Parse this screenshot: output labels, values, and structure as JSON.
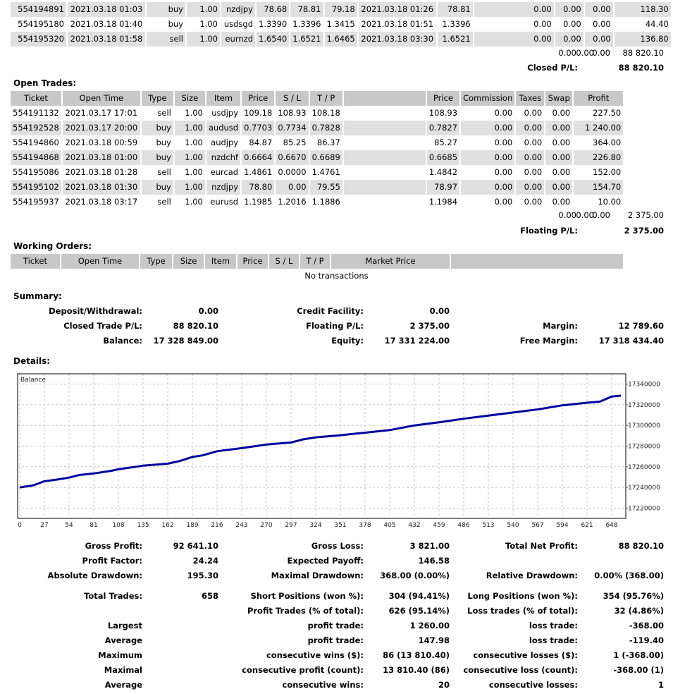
{
  "closed_trades": {
    "rows": [
      {
        "ticket": "554194891",
        "open_time": "2021.03.18 01:03",
        "type": "buy",
        "size": "1.00",
        "item": "nzdjpy",
        "price": "78.68",
        "sl": "78.81",
        "tp": "79.18",
        "close_time": "2021.03.18 01:26",
        "close_price": "78.81",
        "commission": "0.00",
        "taxes": "0.00",
        "swap": "0.00",
        "profit": "118.30"
      },
      {
        "ticket": "554195180",
        "open_time": "2021.03.18 01:40",
        "type": "buy",
        "size": "1.00",
        "item": "usdsgd",
        "price": "1.3390",
        "sl": "1.3396",
        "tp": "1.3415",
        "close_time": "2021.03.18 01:51",
        "close_price": "1.3396",
        "commission": "0.00",
        "taxes": "0.00",
        "swap": "0.00",
        "profit": "44.40"
      },
      {
        "ticket": "554195320",
        "open_time": "2021.03.18 01:58",
        "type": "sell",
        "size": "1.00",
        "item": "eurnzd",
        "price": "1.6540",
        "sl": "1.6521",
        "tp": "1.6465",
        "close_time": "2021.03.18 03:30",
        "close_price": "1.6521",
        "commission": "0.00",
        "taxes": "0.00",
        "swap": "0.00",
        "profit": "136.80"
      }
    ],
    "totals": {
      "commission": "0.00",
      "taxes": "0.00",
      "swap": "0.00",
      "profit": "88 820.10"
    },
    "pl_label": "Closed P/L:",
    "pl_value": "88 820.10"
  },
  "open_trades": {
    "title": "Open Trades:",
    "headers": [
      "Ticket",
      "Open Time",
      "Type",
      "Size",
      "Item",
      "Price",
      "S / L",
      "T / P",
      "",
      "Price",
      "Commission",
      "Taxes",
      "Swap",
      "Profit"
    ],
    "rows": [
      {
        "ticket": "554191132",
        "open_time": "2021.03.17 17:01",
        "type": "sell",
        "size": "1.00",
        "item": "usdjpy",
        "price": "109.18",
        "sl": "108.93",
        "tp": "108.18",
        "market_price": "108.93",
        "commission": "0.00",
        "taxes": "0.00",
        "swap": "0.00",
        "profit": "227.50"
      },
      {
        "ticket": "554192528",
        "open_time": "2021.03.17 20:00",
        "type": "buy",
        "size": "1.00",
        "item": "audusd",
        "price": "0.7703",
        "sl": "0.7734",
        "tp": "0.7828",
        "market_price": "0.7827",
        "commission": "0.00",
        "taxes": "0.00",
        "swap": "0.00",
        "profit": "1 240.00"
      },
      {
        "ticket": "554194860",
        "open_time": "2021.03.18 00:59",
        "type": "buy",
        "size": "1.00",
        "item": "audjpy",
        "price": "84.87",
        "sl": "85.25",
        "tp": "86.37",
        "market_price": "85.27",
        "commission": "0.00",
        "taxes": "0.00",
        "swap": "0.00",
        "profit": "364.00"
      },
      {
        "ticket": "554194868",
        "open_time": "2021.03.18 01:00",
        "type": "buy",
        "size": "1.00",
        "item": "nzdchf",
        "price": "0.6664",
        "sl": "0.6670",
        "tp": "0.6689",
        "market_price": "0.6685",
        "commission": "0.00",
        "taxes": "0.00",
        "swap": "0.00",
        "profit": "226.80"
      },
      {
        "ticket": "554195086",
        "open_time": "2021.03.18 01:28",
        "type": "sell",
        "size": "1.00",
        "item": "eurcad",
        "price": "1.4861",
        "sl": "0.0000",
        "tp": "1.4761",
        "market_price": "1.4842",
        "commission": "0.00",
        "taxes": "0.00",
        "swap": "0.00",
        "profit": "152.00"
      },
      {
        "ticket": "554195102",
        "open_time": "2021.03.18 01:30",
        "type": "buy",
        "size": "1.00",
        "item": "nzdjpy",
        "price": "78.80",
        "sl": "0.00",
        "tp": "79.55",
        "market_price": "78.97",
        "commission": "0.00",
        "taxes": "0.00",
        "swap": "0.00",
        "profit": "154.70"
      },
      {
        "ticket": "554195937",
        "open_time": "2021.03.18 03:17",
        "type": "sell",
        "size": "1.00",
        "item": "eurusd",
        "price": "1.1985",
        "sl": "1.2016",
        "tp": "1.1886",
        "market_price": "1.1984",
        "commission": "0.00",
        "taxes": "0.00",
        "swap": "0.00",
        "profit": "10.00"
      }
    ],
    "totals": {
      "commission": "0.00",
      "taxes": "0.00",
      "swap": "0.00",
      "profit": "2 375.00"
    },
    "pl_label": "Floating P/L:",
    "pl_value": "2 375.00"
  },
  "working_orders": {
    "title": "Working Orders:",
    "headers": [
      "Ticket",
      "Open Time",
      "Type",
      "Size",
      "Item",
      "Price",
      "S / L",
      "T / P",
      "Market Price",
      ""
    ],
    "empty_text": "No transactions"
  },
  "summary": {
    "title": "Summary:",
    "deposit_label": "Deposit/Withdrawal:",
    "deposit_value": "0.00",
    "credit_label": "Credit Facility:",
    "credit_value": "0.00",
    "closed_pl_label": "Closed Trade P/L:",
    "closed_pl_value": "88 820.10",
    "floating_pl_label": "Floating P/L:",
    "floating_pl_value": "2 375.00",
    "margin_label": "Margin:",
    "margin_value": "12 789.60",
    "balance_label": "Balance:",
    "balance_value": "17 328 849.00",
    "equity_label": "Equity:",
    "equity_value": "17 331 224.00",
    "free_margin_label": "Free Margin:",
    "free_margin_value": "17 318 434.40"
  },
  "details": {
    "title": "Details:"
  },
  "chart_data": {
    "type": "line",
    "title": "Balance",
    "xlabel": "",
    "ylabel": "",
    "x_ticks": [
      0,
      27,
      54,
      81,
      108,
      135,
      162,
      189,
      216,
      243,
      270,
      297,
      324,
      351,
      378,
      405,
      432,
      459,
      486,
      513,
      540,
      567,
      594,
      621,
      648
    ],
    "y_ticks": [
      17220000,
      17240000,
      17260000,
      17280000,
      17300000,
      17320000,
      17340000
    ],
    "xlim": [
      0,
      658
    ],
    "ylim": [
      17210000,
      17350000
    ],
    "grid": true,
    "line_color": "#0000a0",
    "series": [
      {
        "name": "Balance",
        "x": [
          0,
          15,
          27,
          40,
          54,
          65,
          81,
          100,
          108,
          135,
          162,
          175,
          189,
          200,
          216,
          243,
          270,
          297,
          310,
          324,
          351,
          378,
          405,
          432,
          459,
          486,
          513,
          540,
          567,
          594,
          621,
          635,
          648,
          658
        ],
        "values": [
          17240000,
          17242000,
          17246000,
          17247500,
          17249500,
          17252000,
          17253500,
          17256000,
          17257500,
          17261000,
          17263000,
          17265500,
          17269500,
          17271000,
          17275000,
          17278000,
          17281500,
          17283500,
          17286500,
          17288500,
          17290500,
          17293000,
          17295500,
          17300000,
          17303000,
          17306500,
          17309500,
          17312500,
          17315500,
          17319500,
          17322000,
          17323000,
          17328000,
          17328849
        ]
      }
    ]
  },
  "stats": {
    "gross_profit_label": "Gross Profit:",
    "gross_profit_value": "92 641.10",
    "gross_loss_label": "Gross Loss:",
    "gross_loss_value": "3 821.00",
    "total_net_profit_label": "Total Net Profit:",
    "total_net_profit_value": "88 820.10",
    "profit_factor_label": "Profit Factor:",
    "profit_factor_value": "24.24",
    "expected_payoff_label": "Expected Payoff:",
    "expected_payoff_value": "146.58",
    "absolute_drawdown_label": "Absolute Drawdown:",
    "absolute_drawdown_value": "195.30",
    "maximal_drawdown_label": "Maximal Drawdown:",
    "maximal_drawdown_value": "368.00 (0.00%)",
    "relative_drawdown_label": "Relative Drawdown:",
    "relative_drawdown_value": "0.00% (368.00)",
    "total_trades_label": "Total Trades:",
    "total_trades_value": "658",
    "short_positions_label": "Short Positions (won %):",
    "short_positions_value": "304 (94.41%)",
    "long_positions_label": "Long Positions (won %):",
    "long_positions_value": "354 (95.76%)",
    "profit_trades_label": "Profit Trades (% of total):",
    "profit_trades_value": "626 (95.14%)",
    "loss_trades_label": "Loss trades (% of total):",
    "loss_trades_value": "32 (4.86%)",
    "largest_label": "Largest",
    "largest_profit_label": "profit trade:",
    "largest_profit_value": "1 260.00",
    "largest_loss_label": "loss trade:",
    "largest_loss_value": "-368.00",
    "average_label": "Average",
    "average_profit_label": "profit trade:",
    "average_profit_value": "147.98",
    "average_loss_label": "loss trade:",
    "average_loss_value": "-119.40",
    "maximum_label": "Maximum",
    "max_consec_wins_label": "consecutive wins ($):",
    "max_consec_wins_value": "86 (13 810.40)",
    "max_consec_losses_label": "consecutive losses ($):",
    "max_consec_losses_value": "1 (-368.00)",
    "maximal_label": "Maximal",
    "maximal_consec_profit_label": "consecutive profit (count):",
    "maximal_consec_profit_value": "13 810.40 (86)",
    "maximal_consec_loss_label": "consecutive loss (count):",
    "maximal_consec_loss_value": "-368.00 (1)",
    "average2_label": "Average",
    "avg_consec_wins_label": "consecutive wins:",
    "avg_consec_wins_value": "20",
    "avg_consec_losses_label": "consecutive losses:",
    "avg_consec_losses_value": "1"
  }
}
